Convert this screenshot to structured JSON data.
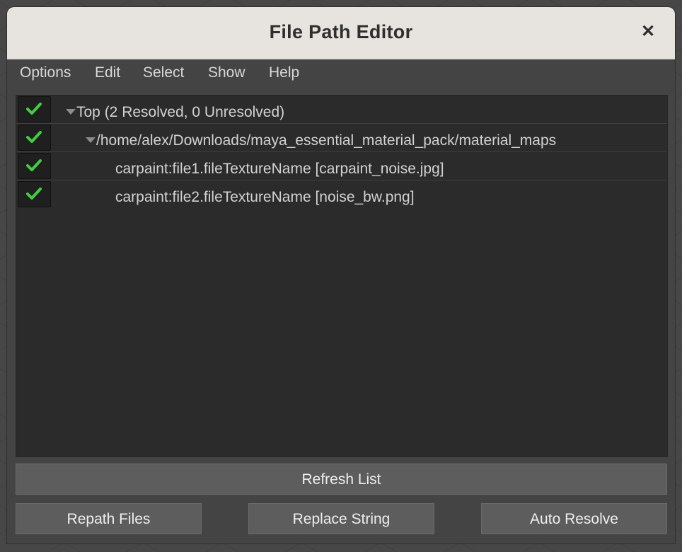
{
  "window": {
    "title": "File Path Editor",
    "close_glyph": "✕"
  },
  "menubar": {
    "items": [
      "Options",
      "Edit",
      "Select",
      "Show",
      "Help"
    ]
  },
  "tree": {
    "rows": [
      {
        "label": "Top (2 Resolved, 0 Unresolved)",
        "checked": true,
        "expanded": true
      },
      {
        "label": "/home/alex/Downloads/maya_essential_material_pack/material_maps",
        "checked": true,
        "expanded": true
      },
      {
        "label": "carpaint:file1.fileTextureName [carpaint_noise.jpg]",
        "checked": true
      },
      {
        "label": "carpaint:file2.fileTextureName [noise_bw.png]",
        "checked": true
      }
    ]
  },
  "buttons": {
    "refresh": "Refresh List",
    "repath": "Repath Files",
    "replace": "Replace String",
    "auto_resolve": "Auto Resolve"
  },
  "colors": {
    "check": "#3fcf3f",
    "panel": "#2b2b2b",
    "window": "#444444",
    "titlebar": "#e7e4e0"
  }
}
